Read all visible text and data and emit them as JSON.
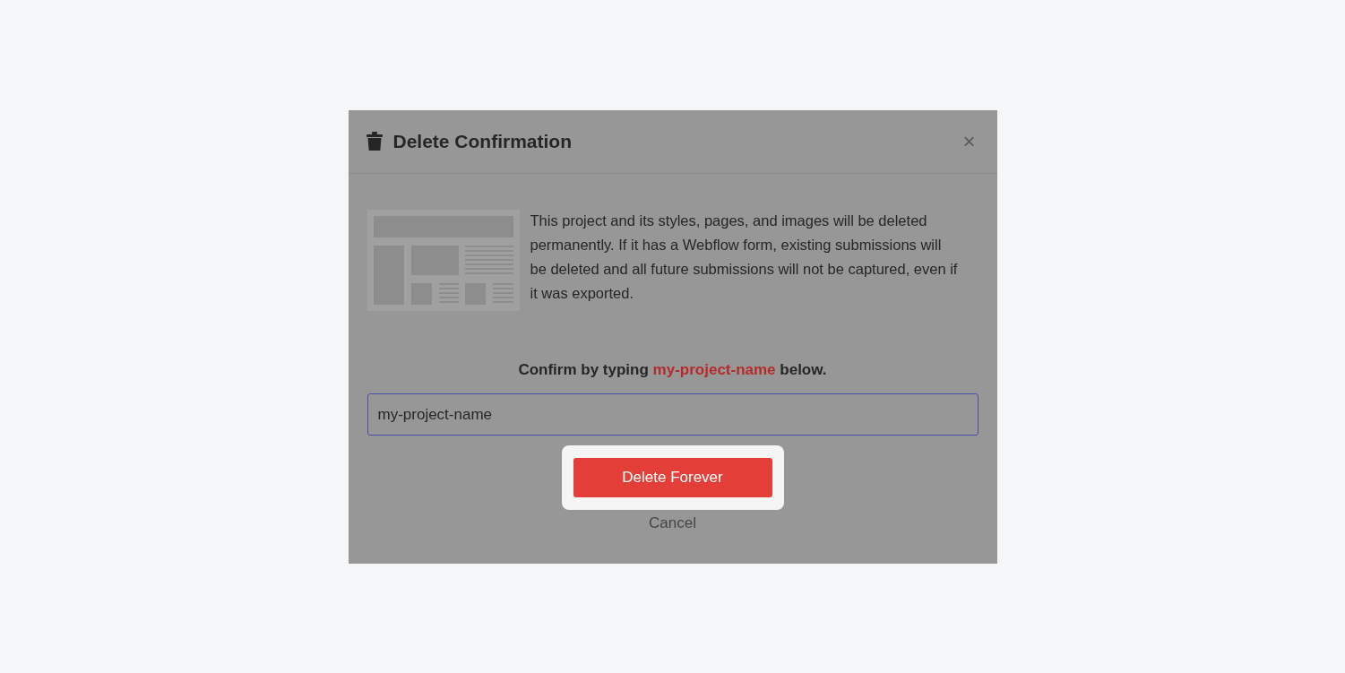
{
  "dialog": {
    "title": "Delete Confirmation",
    "close": "×",
    "message": "This project and its styles, pages, and images will be deleted permanently. If it has a Webflow form, existing submissions will be deleted and all future submissions will not be captured, even if it was exported.",
    "confirm": {
      "before": "Confirm by typing",
      "name": "my-project-name",
      "after": "below."
    },
    "input": {
      "value": "my-project-name",
      "focused": true
    },
    "primary": {
      "label": "Delete Forever",
      "highlighted": true
    },
    "cancel": "Cancel"
  }
}
